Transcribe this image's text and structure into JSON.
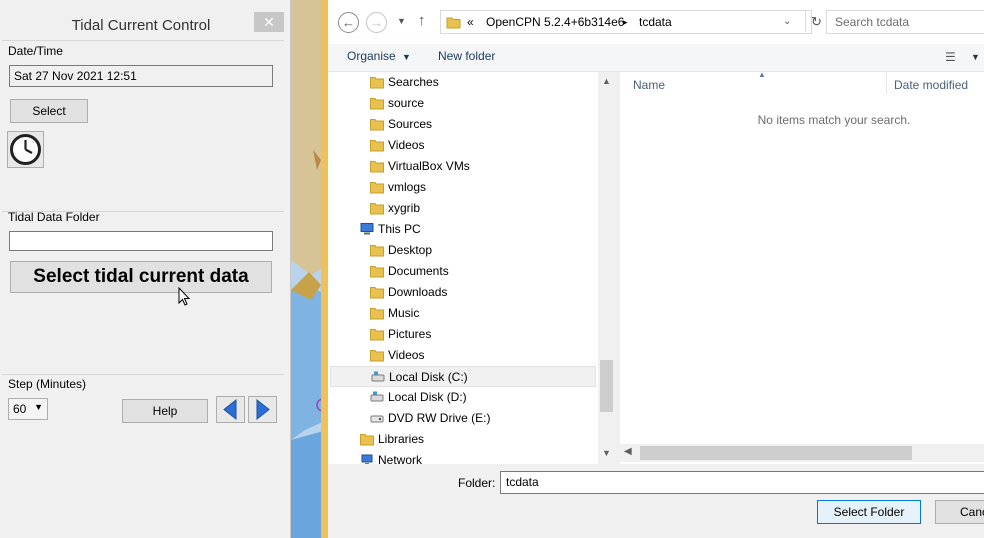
{
  "tidal_panel": {
    "title": "Tidal Current Control",
    "close_label": "✕",
    "datetime_label": "Date/Time",
    "datetime_value": "Sat 27 Nov 2021 12:51",
    "select_label": "Select",
    "folder_label": "Tidal Data Folder",
    "folder_value": "",
    "select_data_label": "Select tidal current data",
    "step_label": "Step (Minutes)",
    "step_value": "60",
    "help_label": "Help"
  },
  "dialog": {
    "breadcrumb": [
      "«",
      "OpenCPN 5.2.4+6b314e6",
      "tcdata"
    ],
    "search_placeholder": "Search tcdata",
    "toolbar": {
      "organise": "Organise",
      "new_folder": "New folder"
    },
    "tree": [
      {
        "label": "Searches",
        "icon": "folder-icon",
        "indent": 1
      },
      {
        "label": "source",
        "icon": "folder-icon",
        "indent": 1
      },
      {
        "label": "Sources",
        "icon": "folder-icon",
        "indent": 1
      },
      {
        "label": "Videos",
        "icon": "folder-icon",
        "indent": 1
      },
      {
        "label": "VirtualBox VMs",
        "icon": "folder-icon",
        "indent": 1
      },
      {
        "label": "vmlogs",
        "icon": "folder-icon",
        "indent": 1
      },
      {
        "label": "xygrib",
        "icon": "folder-icon",
        "indent": 1
      },
      {
        "label": "This PC",
        "icon": "computer-icon",
        "indent": 0
      },
      {
        "label": "Desktop",
        "icon": "folder-icon",
        "indent": 1
      },
      {
        "label": "Documents",
        "icon": "folder-icon",
        "indent": 1
      },
      {
        "label": "Downloads",
        "icon": "folder-icon",
        "indent": 1
      },
      {
        "label": "Music",
        "icon": "folder-icon",
        "indent": 1
      },
      {
        "label": "Pictures",
        "icon": "folder-icon",
        "indent": 1
      },
      {
        "label": "Videos",
        "icon": "folder-icon",
        "indent": 1
      },
      {
        "label": "Local Disk (C:)",
        "icon": "drive-icon",
        "indent": 1,
        "state": "hover"
      },
      {
        "label": "Local Disk (D:)",
        "icon": "drive-icon",
        "indent": 1
      },
      {
        "label": "DVD RW Drive (E:)",
        "icon": "dvd-drive-icon",
        "indent": 1
      },
      {
        "label": "Libraries",
        "icon": "folder-icon",
        "indent": 0
      },
      {
        "label": "Network",
        "icon": "network-icon",
        "indent": 0
      }
    ],
    "columns": {
      "name": "Name",
      "date_modified": "Date modified"
    },
    "empty_message": "No items match your search.",
    "folder_label": "Folder:",
    "folder_value": "tcdata",
    "select_folder_label": "Select Folder",
    "cancel_label": "Cancel"
  },
  "colors": {
    "accent": "#0078d7",
    "folder": "#e8c14f",
    "arrow_button": "#2a6fd6"
  }
}
